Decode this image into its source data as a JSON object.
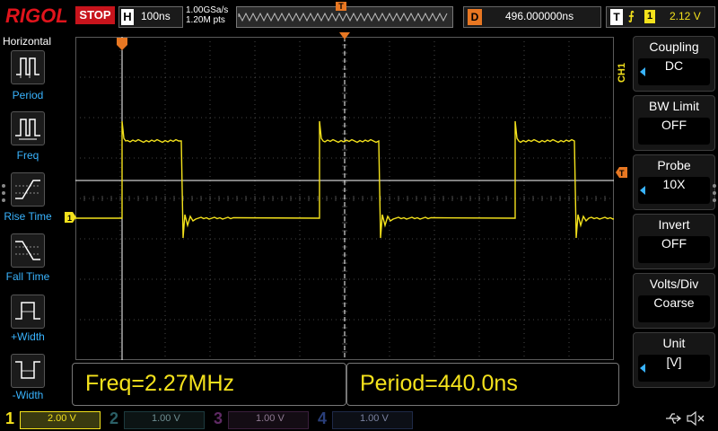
{
  "header": {
    "brand": "RIGOL",
    "run_state": "STOP",
    "horizontal_key": "H",
    "timebase": "100ns",
    "sample_rate": "1.00GSa/s",
    "memory_depth": "1.20M pts",
    "trigger_marker": "T",
    "delay_key": "D",
    "delay": "496.000000ns",
    "trigger_key": "T",
    "trigger_edge": "f",
    "trigger_source": "1",
    "trigger_level": "2.12 V"
  },
  "left_menu": {
    "title": "Horizontal",
    "items": [
      {
        "label": "Period",
        "icon": "period-icon"
      },
      {
        "label": "Freq",
        "icon": "frequency-icon"
      },
      {
        "label": "Rise Time",
        "icon": "rise-time-icon"
      },
      {
        "label": "Fall Time",
        "icon": "fall-time-icon"
      },
      {
        "label": "+Width",
        "icon": "positive-width-icon"
      },
      {
        "label": "-Width",
        "icon": "negative-width-icon"
      }
    ]
  },
  "right_menu": {
    "channel_tag": "CH1",
    "items": [
      {
        "title": "Coupling",
        "value": "DC",
        "has_arrow": true
      },
      {
        "title": "BW Limit",
        "value": "OFF",
        "has_arrow": false
      },
      {
        "title": "Probe",
        "value": "10X",
        "has_arrow": true
      },
      {
        "title": "Invert",
        "value": "OFF",
        "has_arrow": false
      },
      {
        "title": "Volts/Div",
        "value": "Coarse",
        "has_arrow": false
      },
      {
        "title": "Unit",
        "value": "[V]",
        "has_arrow": true
      }
    ]
  },
  "measurements": {
    "frequency": "Freq=2.27MHz",
    "period": "Period=440.0ns"
  },
  "waveform": {
    "channel_marker": "1",
    "trigger_level_marker": "T",
    "color": "#f4e21c",
    "trigger_color": "#e87722",
    "grid_color": "#5a5a5a"
  },
  "channels": [
    {
      "number": "1",
      "scale": "2.00 V",
      "color": "#f4e21c",
      "active": true
    },
    {
      "number": "2",
      "scale": "1.00 V",
      "color": "#27b5c8",
      "active": false
    },
    {
      "number": "3",
      "scale": "1.00 V",
      "color": "#c43ac8",
      "active": false
    },
    {
      "number": "4",
      "scale": "1.00 V",
      "color": "#3a6ad8",
      "active": false
    }
  ],
  "status_icons": [
    "usb-icon",
    "speaker-mute-icon"
  ]
}
